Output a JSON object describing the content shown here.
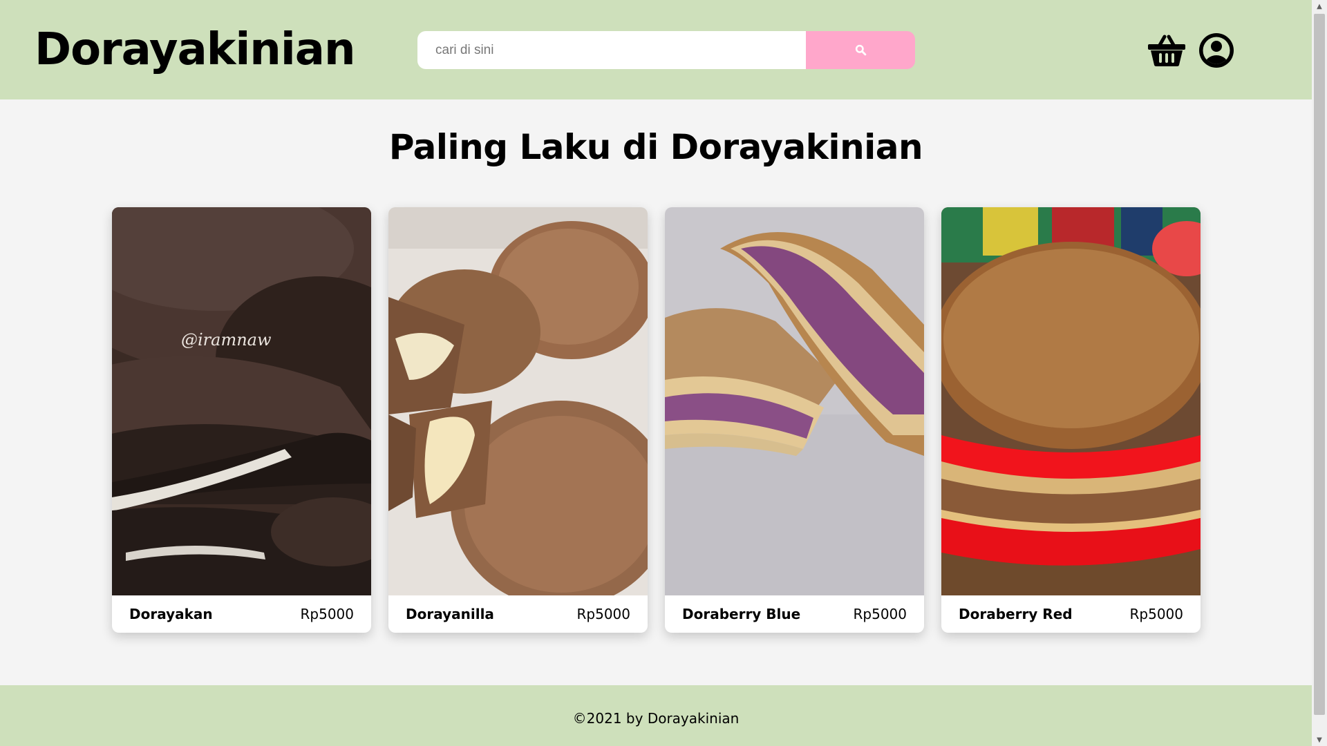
{
  "header": {
    "logo": "Dorayakinian",
    "search_placeholder": "cari di sini",
    "search_icon": "search-icon",
    "cart_icon": "basket-icon",
    "account_icon": "user-circle-icon"
  },
  "main": {
    "title": "Paling Laku di Dorayakinian",
    "products": [
      {
        "name": "Dorayakan",
        "price": "Rp5000",
        "image_watermark": "@iramnaw"
      },
      {
        "name": "Dorayanilla",
        "price": "Rp5000"
      },
      {
        "name": "Doraberry Blue",
        "price": "Rp5000"
      },
      {
        "name": "Doraberry Red",
        "price": "Rp5000"
      }
    ]
  },
  "footer": {
    "text": "©2021 by Dorayakinian"
  },
  "colors": {
    "header_bg": "#cee0bb",
    "search_button": "#ffa7cb",
    "page_bg": "#f4f4f4"
  }
}
